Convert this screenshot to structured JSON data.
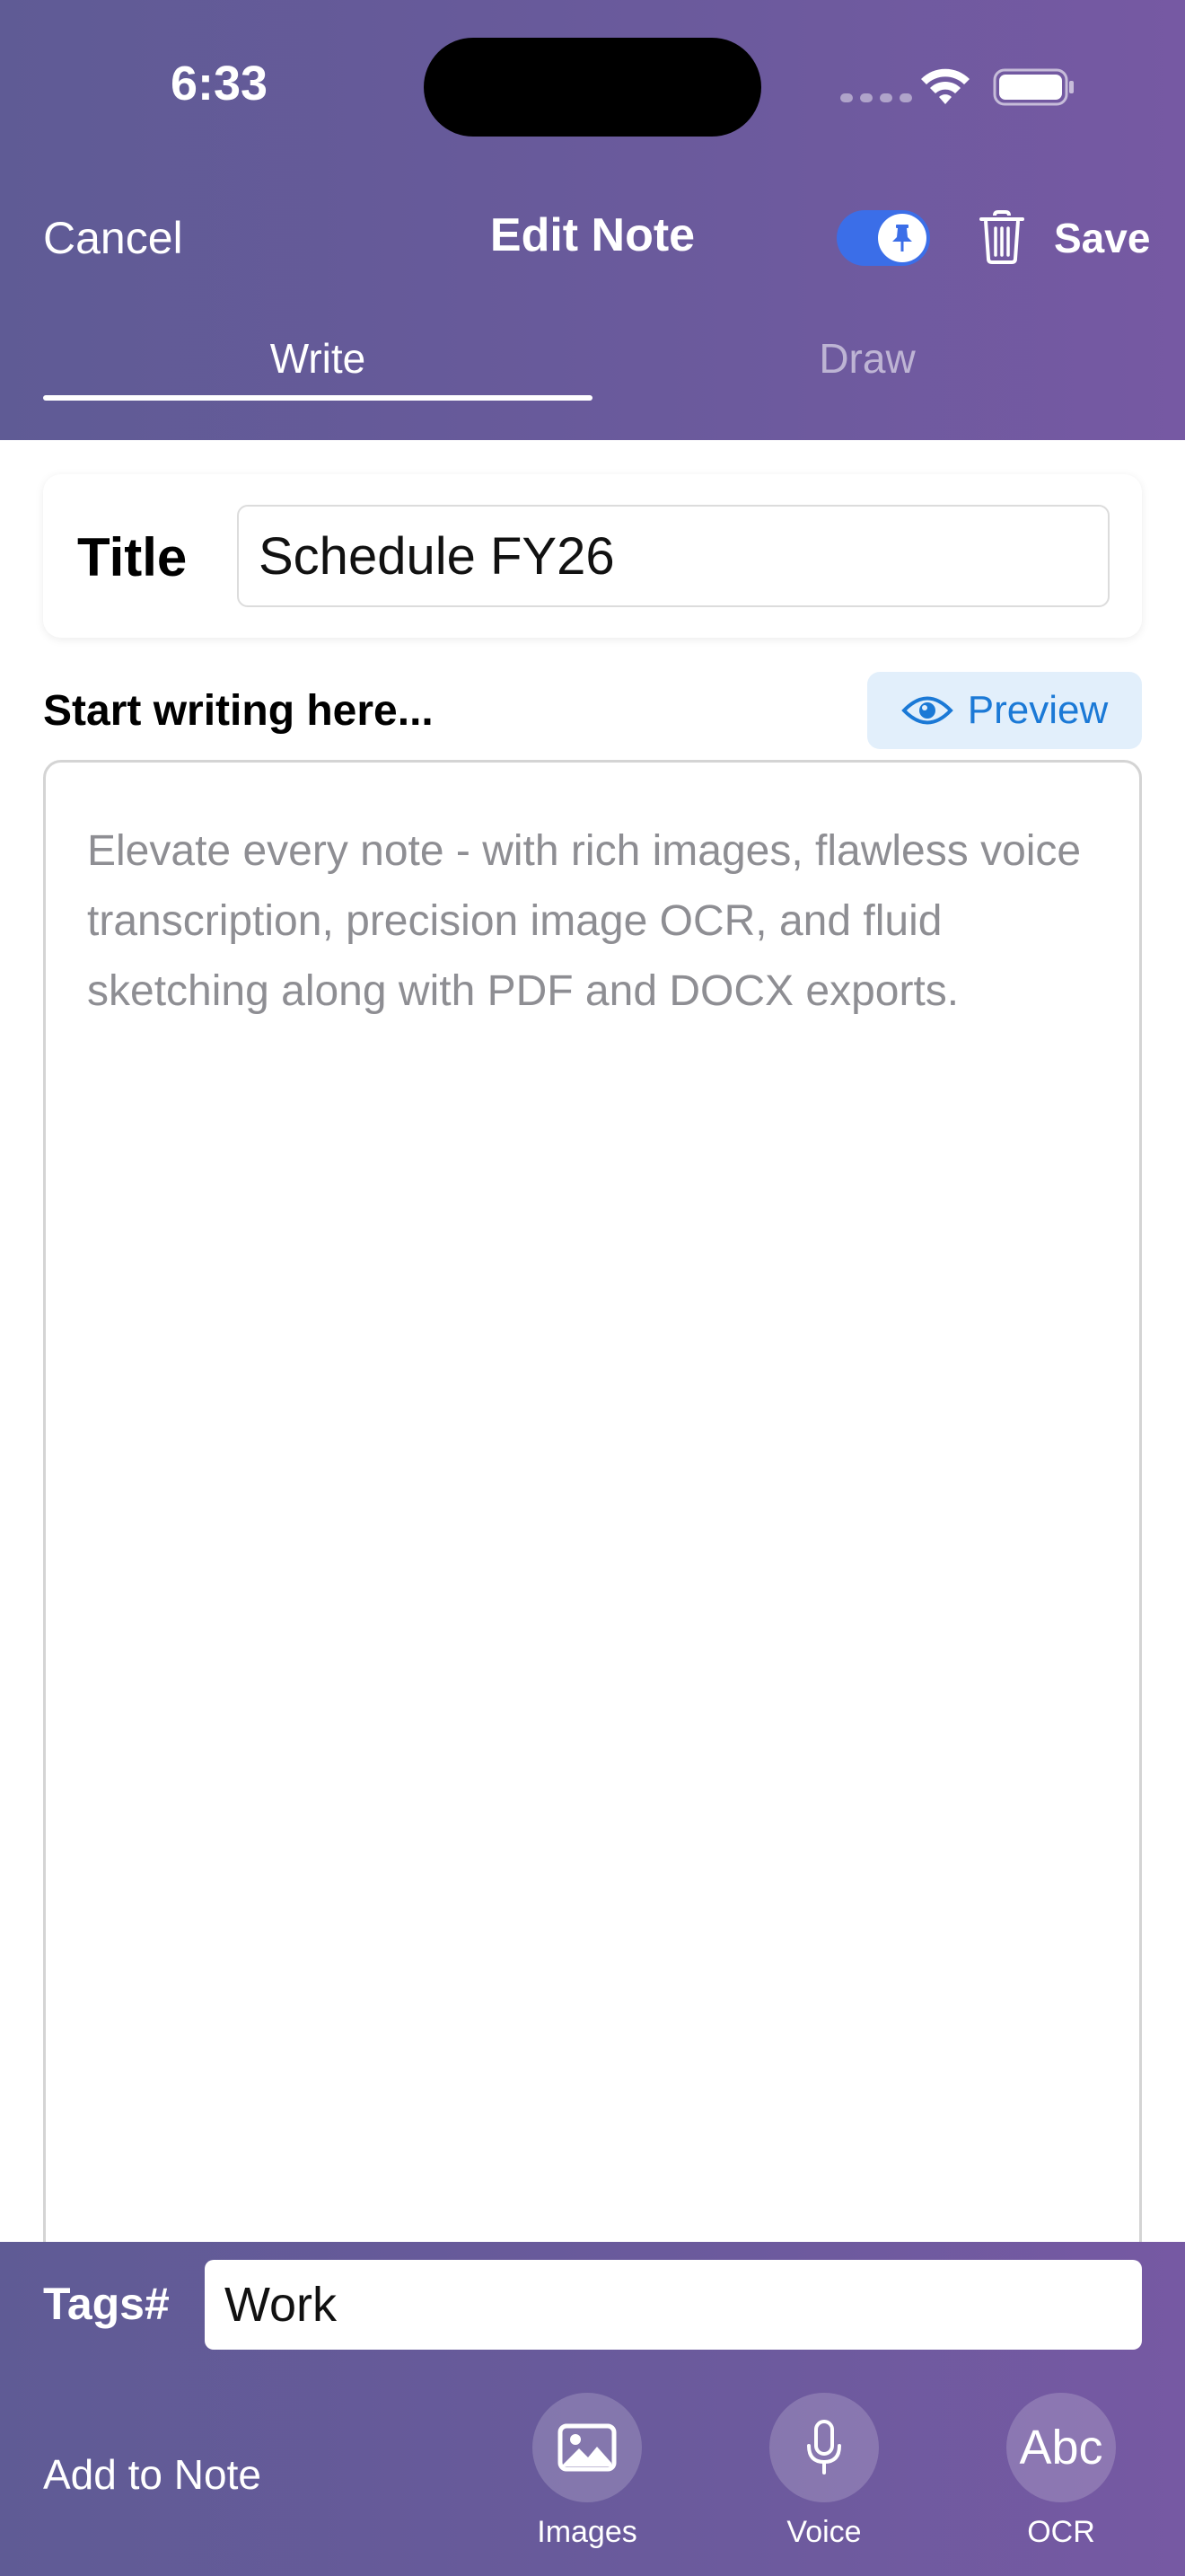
{
  "status_bar": {
    "time": "6:33"
  },
  "nav": {
    "cancel_label": "Cancel",
    "title": "Edit Note",
    "save_label": "Save",
    "pin_enabled": true
  },
  "tabs": [
    {
      "label": "Write",
      "active": true
    },
    {
      "label": "Draw",
      "active": false
    }
  ],
  "title_field": {
    "label": "Title",
    "value": "Schedule FY26"
  },
  "editor": {
    "prompt": "Start writing here...",
    "preview_label": "Preview",
    "placeholder": "Elevate every note - with rich images, flawless voice transcription, precision image OCR, and fluid sketching along with PDF and DOCX exports."
  },
  "tags": {
    "label": "Tags#",
    "value": "Work"
  },
  "add_to_note": {
    "label": "Add to Note",
    "tools": [
      {
        "label": "Images",
        "icon": "image-icon"
      },
      {
        "label": "Voice",
        "icon": "microphone-icon"
      },
      {
        "label": "OCR",
        "icon": "ocr-icon",
        "glyph": "Abc"
      }
    ]
  },
  "colors": {
    "header_gradient_start": "#5f5b95",
    "header_gradient_end": "#7659a3",
    "toggle_on": "#3b6ee8",
    "preview_accent": "#1b79d6"
  }
}
